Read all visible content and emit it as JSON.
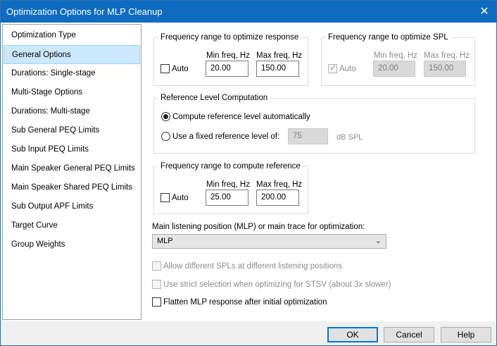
{
  "window": {
    "title": "Optimization Options for MLP Cleanup"
  },
  "nav": {
    "items": [
      {
        "label": "Optimization Type"
      },
      {
        "label": "General Options",
        "selected": true
      },
      {
        "label": "Durations: Single-stage"
      },
      {
        "label": "Multi-Stage Options"
      },
      {
        "label": "Durations: Multi-stage"
      },
      {
        "label": "Sub General PEQ Limits"
      },
      {
        "label": "Sub Input PEQ Limits"
      },
      {
        "label": "Main Speaker General PEQ Limits"
      },
      {
        "label": "Main Speaker Shared PEQ Limits"
      },
      {
        "label": "Sub Output APF Limits"
      },
      {
        "label": "Target Curve"
      },
      {
        "label": "Group Weights"
      }
    ]
  },
  "freq_response": {
    "title": "Frequency range to optimize response",
    "auto_label": "Auto",
    "min_label": "Min freq, Hz",
    "max_label": "Max freq, Hz",
    "min_value": "20.00",
    "max_value": "150.00"
  },
  "freq_spl": {
    "title": "Frequency range to optimize SPL",
    "auto_label": "Auto",
    "min_label": "Min freq, Hz",
    "max_label": "Max freq, Hz",
    "min_value": "20.00",
    "max_value": "150.00"
  },
  "ref_level": {
    "title": "Reference Level Computation",
    "auto_label": "Compute reference level automatically",
    "fixed_label": "Use a fixed reference level of:",
    "fixed_value": "75",
    "unit": "dB SPL"
  },
  "freq_ref": {
    "title": "Frequency range to compute reference",
    "auto_label": "Auto",
    "min_label": "Min freq, Hz",
    "max_label": "Max freq, Hz",
    "min_value": "25.00",
    "max_value": "200.00"
  },
  "mlp": {
    "label": "Main listening position (MLP) or main trace for optimization:",
    "selected": "MLP"
  },
  "options": {
    "allow_spl": "Allow different SPLs at different listening positions",
    "strict": "Use strict selection when optimizing for STSV (about 3x slower)",
    "flatten": "Flatten MLP response after initial optimization"
  },
  "footer": {
    "ok": "OK",
    "cancel": "Cancel",
    "help": "Help"
  },
  "colors": {
    "titlebar": "#0f6bbf",
    "selection": "#cce8ff",
    "default_button_border": "#0078d7"
  }
}
